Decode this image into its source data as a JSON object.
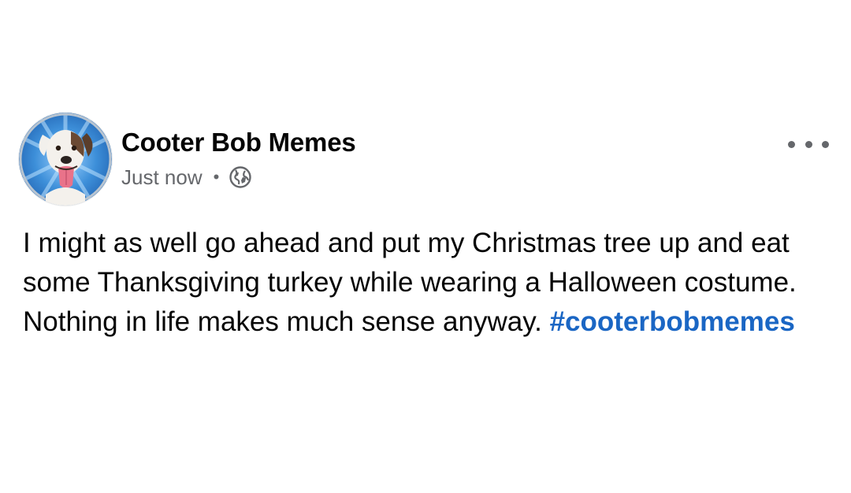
{
  "post": {
    "author": "Cooter Bob Memes",
    "timestamp": "Just now",
    "separator": "•",
    "audience_icon": "globe-icon",
    "more_icon": "more-options-icon",
    "avatar_icon": "dog-avatar-icon",
    "body_text": "I might as well go ahead and put my Christmas tree up and eat some Thanksgiving turkey while wearing a Halloween costume. Nothing in life makes much sense anyway.",
    "hashtag": "#cooterbobmemes"
  },
  "colors": {
    "text": "#050505",
    "secondary_text": "#65676b",
    "hashtag": "#1a66c4",
    "avatar_bg": "#3d8fd9"
  }
}
